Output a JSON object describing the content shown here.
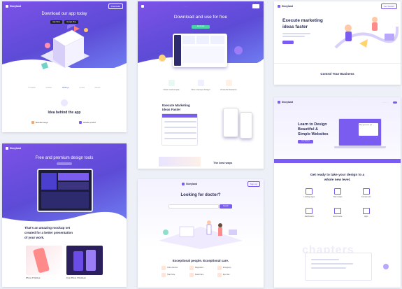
{
  "card1": {
    "brand": "Storyland",
    "nav_button": "Download",
    "hero_title": "Download our app today",
    "store_buttons": [
      "App Store",
      "Google Play"
    ],
    "partners": [
      "Unsplash",
      "Fishbox",
      "Bullseye",
      "Crowd",
      "Mosaic"
    ],
    "section_title": "Idea behind the app",
    "features": [
      "Beautiful design",
      "Reliable product"
    ],
    "accent": "#7b5cf0"
  },
  "card2": {
    "hero_title": "Download and use for free",
    "cta": "Get it now",
    "features": [
      "Clean and simple",
      "Nice concept design",
      "Powerful features"
    ],
    "section_title": [
      "Execute Marketing",
      "Ideas Faster"
    ],
    "bottom_text": "The best ways"
  },
  "card3": {
    "brand": "Storyland",
    "nav_button": "Get Started",
    "hero_title": [
      "Execute marketing",
      "ideas faster"
    ],
    "section_title": "Control Your Business"
  },
  "card4": {
    "brand": "Storyland",
    "hero_title": "Free and premium design tools",
    "body_lines": [
      "That's an amazing mockup set",
      "created for a better presentation",
      "of your work."
    ],
    "body_highlight": "amazing mockup set",
    "captions": [
      "iPhone X Mockup",
      "Free iPhone X Mockups"
    ]
  },
  "card5": {
    "brand": "Storyland",
    "nav_button": "Sign up",
    "hero_title": "Looking for doctor?",
    "search_button": "Search",
    "section_title": "Exceptional people. Exceptional care.",
    "services": [
      "Online Doctors",
      "Diagnostics",
      "Emergency",
      "Heart Care",
      "Dental Care",
      "Eye Care"
    ]
  },
  "card6": {
    "brand": "Storyland",
    "hero_title": [
      "Learn to Design",
      "Beautiful &",
      "Simple Websites"
    ],
    "hero_cta": "Get Started",
    "mockup_label": "Blog generator pro",
    "section_title": [
      "Get ready to take your design to a",
      "whole new level."
    ],
    "features": [
      "Landing pages",
      "Web design",
      "Components",
      "Dashboards",
      "Ecommerce",
      "Apps"
    ],
    "watermark": "chapters"
  }
}
